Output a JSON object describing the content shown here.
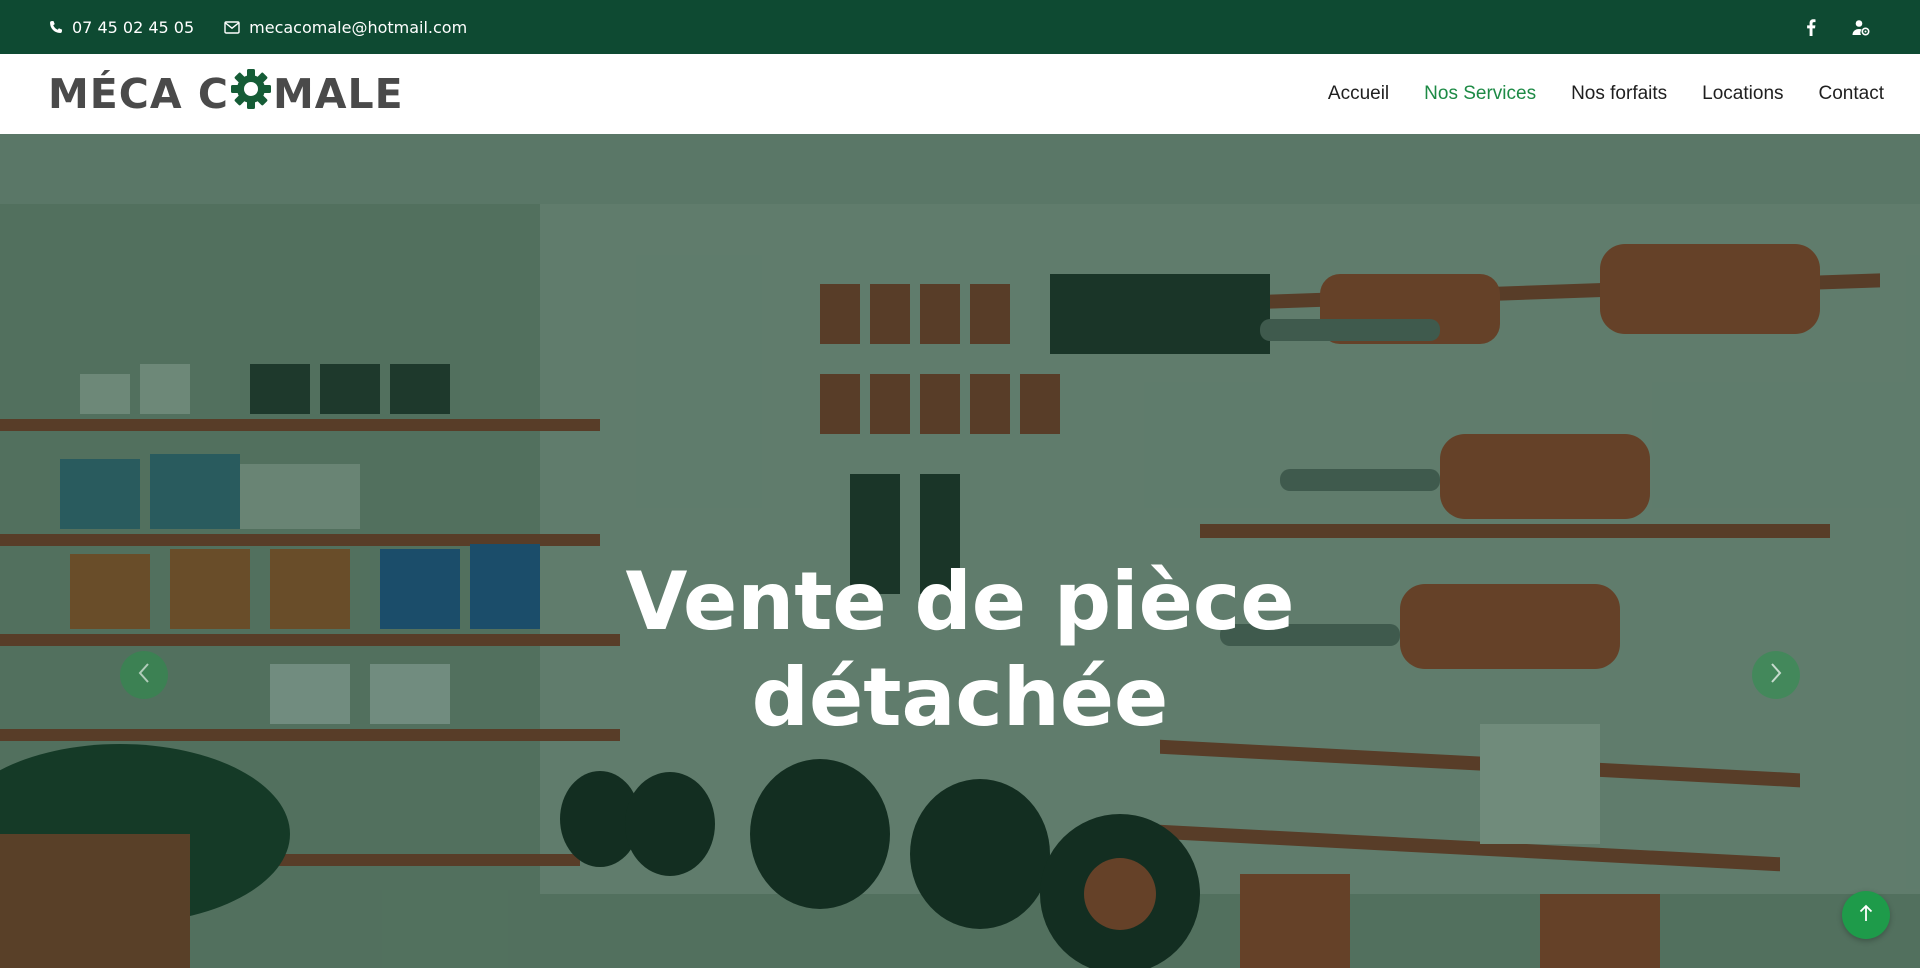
{
  "topbar": {
    "phone": "07 45 02 45 05",
    "email": "mecacomale@hotmail.com",
    "icons": [
      "phone-icon",
      "envelope-icon",
      "facebook-icon",
      "user-cog-icon"
    ]
  },
  "header": {
    "logo_left": "MÉCA C",
    "logo_right": "MALE",
    "nav": [
      {
        "label": "Accueil",
        "active": false
      },
      {
        "label": "Nos Services",
        "active": true
      },
      {
        "label": "Nos forfaits",
        "active": false
      },
      {
        "label": "Locations",
        "active": false
      },
      {
        "label": "Contact",
        "active": false
      }
    ]
  },
  "hero": {
    "title_line1": "Vente de pièce",
    "title_line2": "détachée",
    "prev_icon": "chevron-left-icon",
    "next_icon": "chevron-right-icon"
  },
  "back_to_top_icon": "arrow-up-icon",
  "colors": {
    "topbar_bg": "#0e4a32",
    "accent": "#1d8a45",
    "overlay": "#0c3e26"
  }
}
